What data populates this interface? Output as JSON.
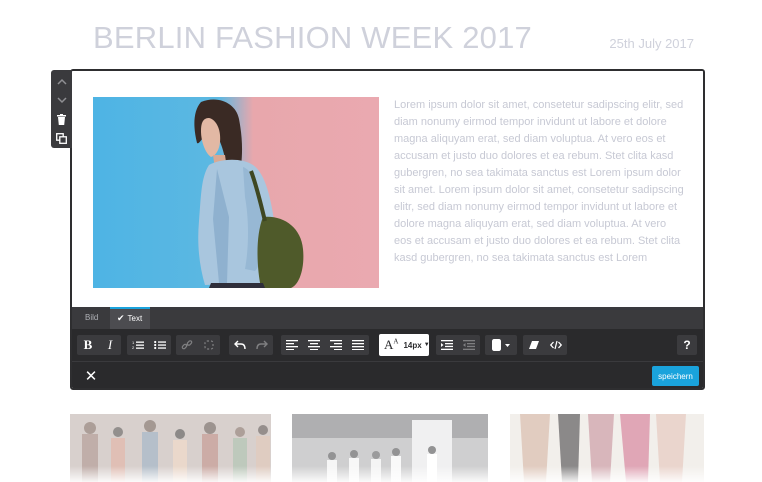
{
  "page": {
    "title": "BERLIN FASHION WEEK 2017",
    "date": "25th July 2017"
  },
  "side_toolbar": {
    "items": [
      "chevron-up-icon",
      "chevron-down-icon",
      "trash-icon",
      "duplicate-icon"
    ]
  },
  "content": {
    "image_description": "woman in denim jacket against blue and pink wall",
    "text": "Lorem ipsum dolor sit amet, consetetur sadipscing elitr, sed diam nonumy eirmod tempor invidunt ut labore et dolore magna aliquyam erat, sed diam voluptua. At vero eos et accusam et justo duo dolores et ea rebum. Stet clita kasd gubergren, no sea takimata sanctus est Lorem ipsum dolor sit amet. Lorem ipsum dolor sit amet, consetetur sadipscing elitr, sed diam nonumy eirmod tempor invidunt ut labore et dolore magna aliquyam erat, sed diam voluptua. At vero eos et accusam et justo duo dolores et ea rebum. Stet clita kasd gubergren, no sea takimata sanctus est Lorem"
  },
  "tabs": [
    {
      "label": "Bild",
      "active": false
    },
    {
      "label": "Text",
      "active": true
    }
  ],
  "format_toolbar": {
    "bold": "B",
    "italic": "I",
    "font_size": "14px",
    "help": "?"
  },
  "action_bar": {
    "close": "✕",
    "save_label": "speichern"
  },
  "colors": {
    "accent": "#1aa3dc",
    "toolbar_bg": "#2a2a2c",
    "title_gray": "#cfd1db"
  }
}
